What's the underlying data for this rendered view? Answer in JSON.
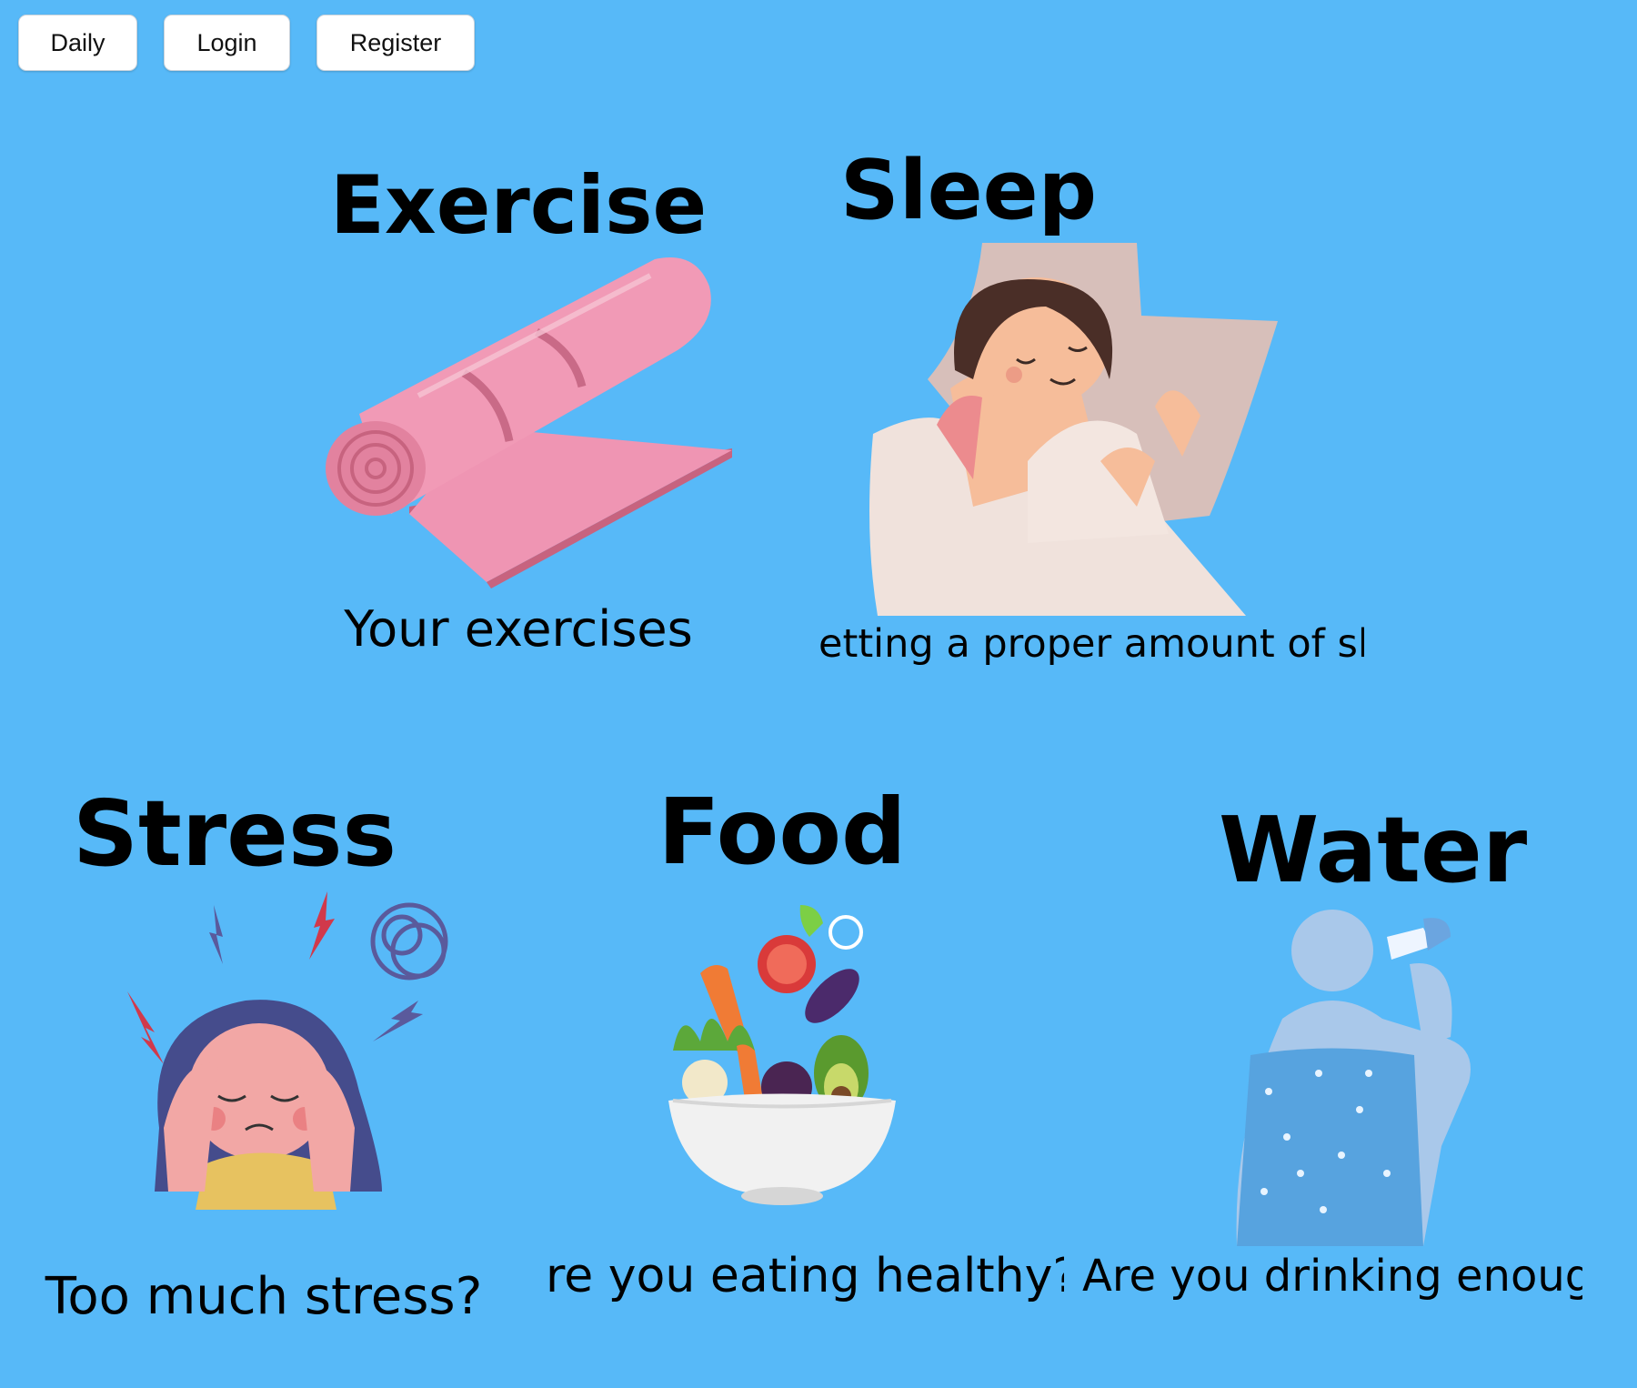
{
  "nav": {
    "daily_label": "Daily",
    "login_label": "Login",
    "register_label": "Register"
  },
  "cards": {
    "exercise": {
      "title": "Exercise",
      "caption": "Your exercises",
      "icon": "yoga-mat-icon"
    },
    "sleep": {
      "title": "Sleep",
      "caption": "etting a proper amount of slee",
      "icon": "sleeping-woman-icon"
    },
    "stress": {
      "title": "Stress",
      "caption": "Too much stress?",
      "icon": "stressed-woman-icon"
    },
    "food": {
      "title": "Food",
      "caption": "re you eating healthy?",
      "icon": "salad-bowl-icon"
    },
    "water": {
      "title": "Water",
      "caption": "Are you drinking enough?",
      "icon": "drinking-man-icon"
    }
  },
  "colors": {
    "background": "#57b9f8",
    "button_bg": "#ffffff",
    "mat_pink": "#ef95b3",
    "text": "#000000"
  }
}
